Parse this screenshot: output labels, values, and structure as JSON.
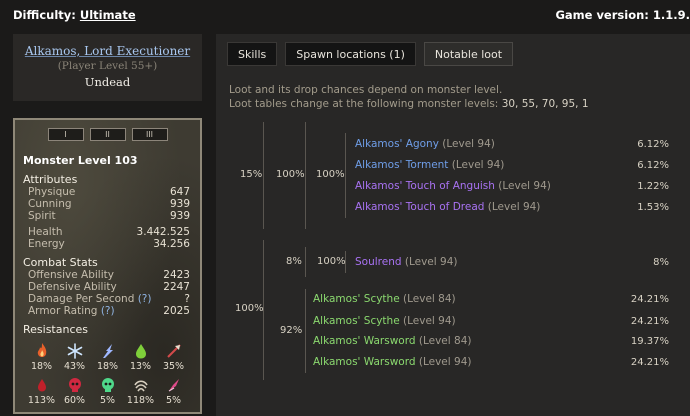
{
  "top": {
    "difficulty_label": "Difficulty:",
    "difficulty_value": "Ultimate",
    "game_version": "Game version: 1.1.9."
  },
  "monster": {
    "name": "Alkamos, Lord Executioner",
    "player_level": "(Player Level 55+)",
    "type": "Undead"
  },
  "stats": {
    "tabs": [
      "I",
      "II",
      "III"
    ],
    "title": "Monster Level 103",
    "attributes_heading": "Attributes",
    "attributes": [
      {
        "label": "Physique",
        "value": "647"
      },
      {
        "label": "Cunning",
        "value": "939"
      },
      {
        "label": "Spirit",
        "value": "939"
      }
    ],
    "vitals": [
      {
        "label": "Health",
        "value": "3.442.525"
      },
      {
        "label": "Energy",
        "value": "34.256"
      }
    ],
    "combat_heading": "Combat Stats",
    "combat": [
      {
        "label": "Offensive Ability",
        "value": "2423",
        "help": ""
      },
      {
        "label": "Defensive Ability",
        "value": "2247",
        "help": ""
      },
      {
        "label": "Damage Per Second",
        "value": "?",
        "help": "(?)"
      },
      {
        "label": "Armor Rating",
        "value": "2025",
        "help": "(?)"
      }
    ],
    "resist_heading": "Resistances",
    "resistances": [
      {
        "icon": "fire-icon",
        "value": "18%",
        "color": "#e8602a"
      },
      {
        "icon": "cold-icon",
        "value": "43%",
        "color": "#cfe6ff"
      },
      {
        "icon": "lightning-icon",
        "value": "18%",
        "color": "#9fb8ff"
      },
      {
        "icon": "poison-icon",
        "value": "13%",
        "color": "#7fcf3a"
      },
      {
        "icon": "pierce-icon",
        "value": "35%",
        "color": "#d24a4a"
      },
      {
        "icon": "bleed-icon",
        "value": "113%",
        "color": "#c0202a"
      },
      {
        "icon": "vitality-icon",
        "value": "60%",
        "color": "#d02840"
      },
      {
        "icon": "aether-icon",
        "value": "5%",
        "color": "#4fd88a"
      },
      {
        "icon": "chaos-icon",
        "value": "118%",
        "color": "#d8d0c0"
      },
      {
        "icon": "stun-icon",
        "value": "5%",
        "color": "#e04a8a"
      }
    ]
  },
  "loot": {
    "tabs": [
      "Skills",
      "Spawn locations (1)",
      "Notable loot"
    ],
    "note_line1": "Loot and its drop chances depend on monster level.",
    "note_line2": "Loot tables change at the following monster levels:",
    "note_levels": "30, 55, 70, 95, 1",
    "group1": {
      "p1": "15%",
      "p2": "100%",
      "p3": "100%",
      "items": [
        {
          "name": "Alkamos' Agony",
          "level": "(Level 94)",
          "pct": "6.12%",
          "rarity": "blue"
        },
        {
          "name": "Alkamos' Torment",
          "level": "(Level 94)",
          "pct": "6.12%",
          "rarity": "blue"
        },
        {
          "name": "Alkamos' Touch of Anguish",
          "level": "(Level 94)",
          "pct": "1.22%",
          "rarity": "purple"
        },
        {
          "name": "Alkamos' Touch of Dread",
          "level": "(Level 94)",
          "pct": "1.53%",
          "rarity": "purple"
        }
      ]
    },
    "group2": {
      "p1": "100%",
      "sub1": {
        "p2": "8%",
        "p3": "100%",
        "items": [
          {
            "name": "Soulrend",
            "level": "(Level 94)",
            "pct": "8%",
            "rarity": "purple"
          }
        ]
      },
      "sub2": {
        "p2": "92%",
        "items": [
          {
            "name": "Alkamos' Scythe",
            "level": "(Level 84)",
            "pct": "24.21%",
            "rarity": "green"
          },
          {
            "name": "Alkamos' Scythe",
            "level": "(Level 94)",
            "pct": "24.21%",
            "rarity": "green"
          },
          {
            "name": "Alkamos' Warsword",
            "level": "(Level 84)",
            "pct": "19.37%",
            "rarity": "green"
          },
          {
            "name": "Alkamos' Warsword",
            "level": "(Level 94)",
            "pct": "24.21%",
            "rarity": "green"
          }
        ]
      }
    }
  }
}
